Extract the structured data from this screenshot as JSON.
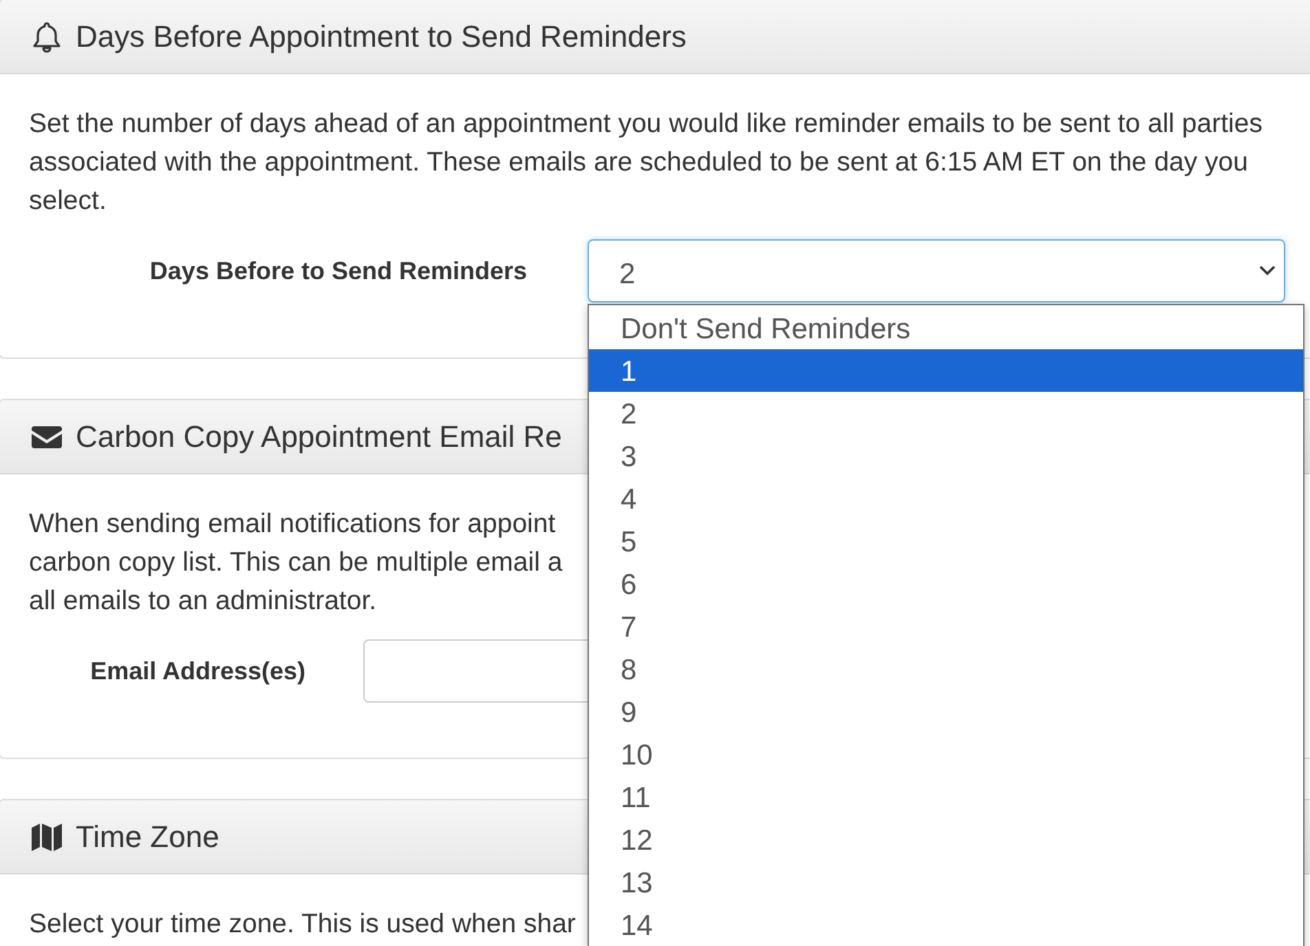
{
  "panels": [
    {
      "title": "Days Before Appointment to Send Reminders",
      "description": "Set the number of days ahead of an appointment you would like reminder emails to be sent to all parties associated with the appointment. These emails are scheduled to be sent at 6:15 AM ET on the day you select.",
      "field": {
        "kind": "select",
        "label": "Days Before to Send Reminders",
        "value": "2"
      }
    },
    {
      "title": "Carbon Copy Appointment Email Re",
      "description_lines": [
        "When sending email notifications for appoint",
        "carbon copy list. This can be multiple email a",
        "all emails to an administrator."
      ],
      "field": {
        "kind": "input",
        "label": "Email Address(es)"
      }
    },
    {
      "title": "Time Zone",
      "description_lines": [
        "Select your time zone. This is used when shar"
      ]
    }
  ],
  "dropdown_options": [
    {
      "label": "Don't Send Reminders",
      "selected": false
    },
    {
      "label": "1",
      "selected": true
    },
    {
      "label": "2",
      "selected": false
    },
    {
      "label": "3",
      "selected": false
    },
    {
      "label": "4",
      "selected": false
    },
    {
      "label": "5",
      "selected": false
    },
    {
      "label": "6",
      "selected": false
    },
    {
      "label": "7",
      "selected": false
    },
    {
      "label": "8",
      "selected": false
    },
    {
      "label": "9",
      "selected": false
    },
    {
      "label": "10",
      "selected": false
    },
    {
      "label": "11",
      "selected": false
    },
    {
      "label": "12",
      "selected": false
    },
    {
      "label": "13",
      "selected": false
    },
    {
      "label": "14",
      "selected": false
    }
  ]
}
